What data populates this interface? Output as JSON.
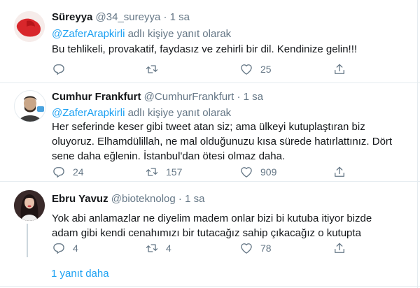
{
  "tweets": [
    {
      "name": "Süreyya",
      "handle": "@34_sureyya",
      "time": "· 1 sa",
      "reply_prefix": "@ZaferArapkirli",
      "reply_suffix": " adlı kişiye yanıt olarak",
      "lines": [
        "Bu tehlikeli, provakatif, faydasız ve zehirli bir dil. Kendinize gelin!!!"
      ],
      "reply_count": "",
      "retweet_count": "",
      "like_count": "25"
    },
    {
      "name": "Cumhur Frankfurt",
      "handle": "@CumhurFrankfurt",
      "time": "· 1 sa",
      "reply_prefix": "@ZaferArapkirli",
      "reply_suffix": " adlı kişiye yanıt olarak",
      "lines": [
        "Her seferinde keser gibi tweet atan siz; ama ülkeyi kutuplaştıran biz",
        "oluyoruz. Elhamdülillah, ne mal olduğunuzu kısa sürede hatırlattınız. Dört",
        "sene daha eğlenin.  İstanbul'dan ötesi olmaz daha."
      ],
      "reply_count": "24",
      "retweet_count": "157",
      "like_count": "909"
    },
    {
      "name": "Ebru Yavuz",
      "handle": "@bioteknolog",
      "time": "· 1 sa",
      "lines": [
        "Yok abi anlamazlar ne diyelim madem onlar bizi bi kutuba itiyor bizde",
        "adam gibi kendi cenahımızı bir tutacağız sahip çıkacağız o kutupta"
      ],
      "reply_count": "4",
      "retweet_count": "4",
      "like_count": "78"
    }
  ],
  "more_replies_label": "1 yanıt daha",
  "icons": {
    "reply": "reply-icon",
    "retweet": "retweet-icon",
    "like": "like-icon",
    "share": "share-icon"
  },
  "colors": {
    "accent": "#1da1f2",
    "muted": "#657786",
    "text": "#14171a",
    "divider": "#e6ecf0"
  }
}
